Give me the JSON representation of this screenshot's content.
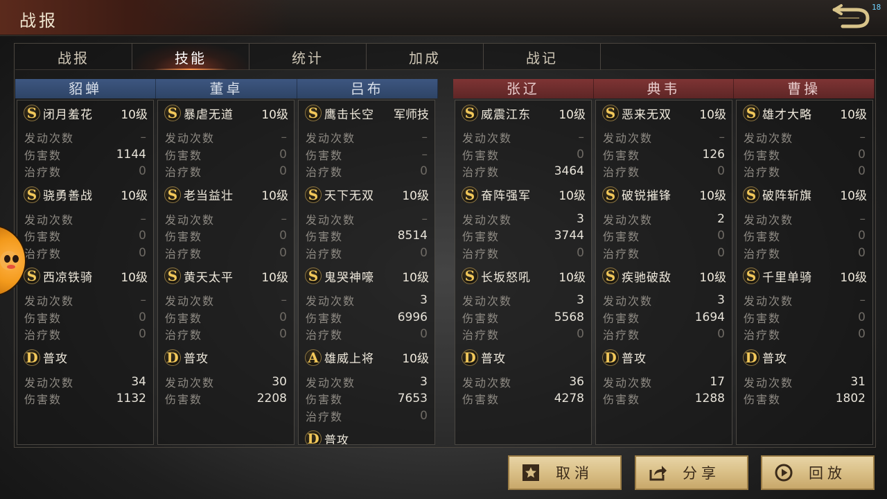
{
  "header": {
    "title": "战报",
    "corner_badge": "18",
    "back_icon": "back-arrow-icon"
  },
  "tabs": [
    {
      "label": "战报",
      "active": false
    },
    {
      "label": "技能",
      "active": true
    },
    {
      "label": "统计",
      "active": false
    },
    {
      "label": "加成",
      "active": false
    },
    {
      "label": "战记",
      "active": false
    }
  ],
  "colors": {
    "blue_team": "#3d5680",
    "red_team": "#7e3434",
    "rank_gold": "#f2c85a"
  },
  "blue_team": {
    "generals": [
      {
        "name": "貂蝉",
        "skills": [
          {
            "rank": "S",
            "name": "闭月羞花",
            "level": "10级",
            "stats": [
              {
                "label": "发动次数",
                "value": "–"
              },
              {
                "label": "伤害数",
                "value": "1144"
              },
              {
                "label": "治疗数",
                "value": "0"
              }
            ]
          },
          {
            "rank": "S",
            "name": "骁勇善战",
            "level": "10级",
            "stats": [
              {
                "label": "发动次数",
                "value": "–"
              },
              {
                "label": "伤害数",
                "value": "0"
              },
              {
                "label": "治疗数",
                "value": "0"
              }
            ]
          },
          {
            "rank": "S",
            "name": "西凉铁骑",
            "level": "10级",
            "stats": [
              {
                "label": "发动次数",
                "value": "–"
              },
              {
                "label": "伤害数",
                "value": "0"
              },
              {
                "label": "治疗数",
                "value": "0"
              }
            ]
          },
          {
            "rank": "D",
            "name": "普攻",
            "level": "",
            "stats": [
              {
                "label": "发动次数",
                "value": "34"
              },
              {
                "label": "伤害数",
                "value": "1132"
              }
            ]
          }
        ]
      },
      {
        "name": "董卓",
        "skills": [
          {
            "rank": "S",
            "name": "暴虐无道",
            "level": "10级",
            "stats": [
              {
                "label": "发动次数",
                "value": "–"
              },
              {
                "label": "伤害数",
                "value": "0"
              },
              {
                "label": "治疗数",
                "value": "0"
              }
            ]
          },
          {
            "rank": "S",
            "name": "老当益壮",
            "level": "10级",
            "stats": [
              {
                "label": "发动次数",
                "value": "–"
              },
              {
                "label": "伤害数",
                "value": "0"
              },
              {
                "label": "治疗数",
                "value": "0"
              }
            ]
          },
          {
            "rank": "S",
            "name": "黄天太平",
            "level": "10级",
            "stats": [
              {
                "label": "发动次数",
                "value": "–"
              },
              {
                "label": "伤害数",
                "value": "0"
              },
              {
                "label": "治疗数",
                "value": "0"
              }
            ]
          },
          {
            "rank": "D",
            "name": "普攻",
            "level": "",
            "stats": [
              {
                "label": "发动次数",
                "value": "30"
              },
              {
                "label": "伤害数",
                "value": "2208"
              }
            ]
          }
        ]
      },
      {
        "name": "吕布",
        "skills": [
          {
            "rank": "S",
            "name": "鹰击长空",
            "level": "军师技",
            "stats": [
              {
                "label": "发动次数",
                "value": "–"
              },
              {
                "label": "伤害数",
                "value": "–"
              },
              {
                "label": "治疗数",
                "value": "0"
              }
            ]
          },
          {
            "rank": "S",
            "name": "天下无双",
            "level": "10级",
            "stats": [
              {
                "label": "发动次数",
                "value": "–"
              },
              {
                "label": "伤害数",
                "value": "8514"
              },
              {
                "label": "治疗数",
                "value": "0"
              }
            ]
          },
          {
            "rank": "S",
            "name": "鬼哭神嚎",
            "level": "10级",
            "stats": [
              {
                "label": "发动次数",
                "value": "3"
              },
              {
                "label": "伤害数",
                "value": "6996"
              },
              {
                "label": "治疗数",
                "value": "0"
              }
            ]
          },
          {
            "rank": "A",
            "name": "雄威上将",
            "level": "10级",
            "stats": [
              {
                "label": "发动次数",
                "value": "3"
              },
              {
                "label": "伤害数",
                "value": "7653"
              },
              {
                "label": "治疗数",
                "value": "0"
              }
            ]
          },
          {
            "rank": "D",
            "name": "普攻",
            "level": "",
            "stats": []
          }
        ]
      }
    ]
  },
  "red_team": {
    "generals": [
      {
        "name": "张辽",
        "skills": [
          {
            "rank": "S",
            "name": "威震江东",
            "level": "10级",
            "stats": [
              {
                "label": "发动次数",
                "value": "–"
              },
              {
                "label": "伤害数",
                "value": "0"
              },
              {
                "label": "治疗数",
                "value": "3464"
              }
            ]
          },
          {
            "rank": "S",
            "name": "奋阵强军",
            "level": "10级",
            "stats": [
              {
                "label": "发动次数",
                "value": "3"
              },
              {
                "label": "伤害数",
                "value": "3744"
              },
              {
                "label": "治疗数",
                "value": "0"
              }
            ]
          },
          {
            "rank": "S",
            "name": "长坂怒吼",
            "level": "10级",
            "stats": [
              {
                "label": "发动次数",
                "value": "3"
              },
              {
                "label": "伤害数",
                "value": "5568"
              },
              {
                "label": "治疗数",
                "value": "0"
              }
            ]
          },
          {
            "rank": "D",
            "name": "普攻",
            "level": "",
            "stats": [
              {
                "label": "发动次数",
                "value": "36"
              },
              {
                "label": "伤害数",
                "value": "4278"
              }
            ]
          }
        ]
      },
      {
        "name": "典韦",
        "skills": [
          {
            "rank": "S",
            "name": "恶来无双",
            "level": "10级",
            "stats": [
              {
                "label": "发动次数",
                "value": "–"
              },
              {
                "label": "伤害数",
                "value": "126"
              },
              {
                "label": "治疗数",
                "value": "0"
              }
            ]
          },
          {
            "rank": "S",
            "name": "破锐摧锋",
            "level": "10级",
            "stats": [
              {
                "label": "发动次数",
                "value": "2"
              },
              {
                "label": "伤害数",
                "value": "0"
              },
              {
                "label": "治疗数",
                "value": "0"
              }
            ]
          },
          {
            "rank": "S",
            "name": "疾驰破敌",
            "level": "10级",
            "stats": [
              {
                "label": "发动次数",
                "value": "3"
              },
              {
                "label": "伤害数",
                "value": "1694"
              },
              {
                "label": "治疗数",
                "value": "0"
              }
            ]
          },
          {
            "rank": "D",
            "name": "普攻",
            "level": "",
            "stats": [
              {
                "label": "发动次数",
                "value": "17"
              },
              {
                "label": "伤害数",
                "value": "1288"
              }
            ]
          }
        ]
      },
      {
        "name": "曹操",
        "skills": [
          {
            "rank": "S",
            "name": "雄才大略",
            "level": "10级",
            "stats": [
              {
                "label": "发动次数",
                "value": "–"
              },
              {
                "label": "伤害数",
                "value": "0"
              },
              {
                "label": "治疗数",
                "value": "0"
              }
            ]
          },
          {
            "rank": "S",
            "name": "破阵斩旗",
            "level": "10级",
            "stats": [
              {
                "label": "发动次数",
                "value": "–"
              },
              {
                "label": "伤害数",
                "value": "0"
              },
              {
                "label": "治疗数",
                "value": "0"
              }
            ]
          },
          {
            "rank": "S",
            "name": "千里单骑",
            "level": "10级",
            "stats": [
              {
                "label": "发动次数",
                "value": "–"
              },
              {
                "label": "伤害数",
                "value": "0"
              },
              {
                "label": "治疗数",
                "value": "0"
              }
            ]
          },
          {
            "rank": "D",
            "name": "普攻",
            "level": "",
            "stats": [
              {
                "label": "发动次数",
                "value": "31"
              },
              {
                "label": "伤害数",
                "value": "1802"
              }
            ]
          }
        ]
      }
    ]
  },
  "buttons": {
    "cancel": {
      "label": "取消",
      "icon": "star-box-icon"
    },
    "share": {
      "label": "分享",
      "icon": "share-icon"
    },
    "replay": {
      "label": "回放",
      "icon": "play-circle-icon"
    }
  }
}
